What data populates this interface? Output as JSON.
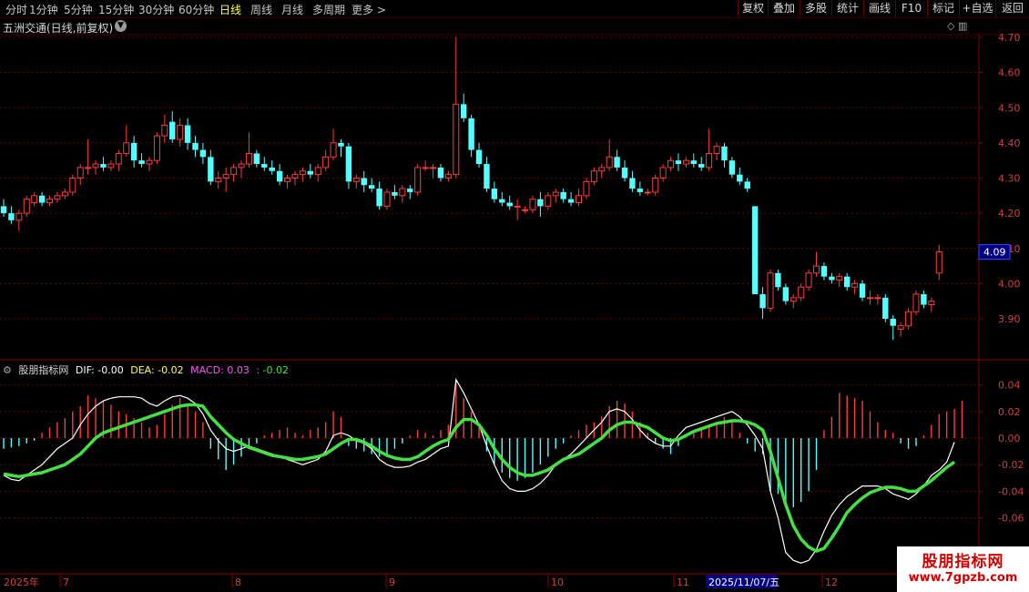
{
  "periods": [
    "分时",
    "1分钟",
    "5分钟",
    "15分钟",
    "30分钟",
    "60分钟",
    "日线",
    "周线",
    "月线",
    "多周期",
    "更多 >"
  ],
  "active_period": "日线",
  "right_buttons": [
    "复权",
    "叠加",
    "多股",
    "统计",
    "画线",
    "F10",
    "标记",
    "+自选",
    "返回"
  ],
  "stock_title": "五洲交通(日线,前复权)",
  "last_price_tag": "4.09",
  "macd_legend": {
    "name": "股朋指标网",
    "dif": "DIF: -0.00",
    "dea": "DEA: -0.02",
    "macd": "MACD: 0.03",
    "bar": ": -0.02"
  },
  "date_axis": {
    "year": "2025年",
    "months": [
      "7",
      "8",
      "9",
      "10",
      "11",
      "12"
    ],
    "highlight": "2025/11/07/五"
  },
  "watermark": {
    "line1": "股朋指标网",
    "line2": "www.7gpzb.com"
  },
  "colors": {
    "up": "#ff3b3b",
    "down": "#54ffff",
    "dif": "#ffffff",
    "dea": "#44e044",
    "axis": "#8a0000"
  },
  "chart_data": {
    "type": "candlestick",
    "price_axis": {
      "ticks": [
        4.7,
        4.6,
        4.5,
        4.4,
        4.3,
        4.2,
        4.1,
        4.0,
        3.9
      ],
      "range": [
        3.82,
        4.73
      ]
    },
    "macd_axis": {
      "ticks": [
        0.04,
        0.02,
        0.0,
        -0.02,
        -0.04,
        -0.06
      ],
      "range": [
        -0.098,
        0.058
      ]
    },
    "candles": [
      [
        4.22,
        4.24,
        4.19,
        4.2
      ],
      [
        4.2,
        4.22,
        4.17,
        4.18
      ],
      [
        4.18,
        4.21,
        4.15,
        4.2
      ],
      [
        4.2,
        4.25,
        4.19,
        4.24
      ],
      [
        4.23,
        4.26,
        4.22,
        4.25
      ],
      [
        4.25,
        4.26,
        4.22,
        4.23
      ],
      [
        4.23,
        4.25,
        4.22,
        4.24
      ],
      [
        4.24,
        4.26,
        4.23,
        4.25
      ],
      [
        4.25,
        4.27,
        4.24,
        4.26
      ],
      [
        4.26,
        4.31,
        4.25,
        4.3
      ],
      [
        4.3,
        4.34,
        4.28,
        4.33
      ],
      [
        4.33,
        4.41,
        4.31,
        4.33
      ],
      [
        4.33,
        4.35,
        4.31,
        4.34
      ],
      [
        4.34,
        4.36,
        4.32,
        4.33
      ],
      [
        4.33,
        4.35,
        4.32,
        4.34
      ],
      [
        4.34,
        4.38,
        4.32,
        4.37
      ],
      [
        4.37,
        4.45,
        4.36,
        4.4
      ],
      [
        4.4,
        4.42,
        4.33,
        4.35
      ],
      [
        4.35,
        4.37,
        4.33,
        4.34
      ],
      [
        4.34,
        4.36,
        4.32,
        4.35
      ],
      [
        4.35,
        4.43,
        4.34,
        4.42
      ],
      [
        4.42,
        4.48,
        4.4,
        4.45
      ],
      [
        4.46,
        4.49,
        4.4,
        4.41
      ],
      [
        4.41,
        4.47,
        4.39,
        4.45
      ],
      [
        4.45,
        4.47,
        4.38,
        4.4
      ],
      [
        4.4,
        4.42,
        4.36,
        4.38
      ],
      [
        4.38,
        4.4,
        4.34,
        4.36
      ],
      [
        4.36,
        4.38,
        4.28,
        4.29
      ],
      [
        4.29,
        4.32,
        4.27,
        4.3
      ],
      [
        4.3,
        4.33,
        4.26,
        4.31
      ],
      [
        4.31,
        4.34,
        4.29,
        4.33
      ],
      [
        4.33,
        4.35,
        4.3,
        4.34
      ],
      [
        4.34,
        4.43,
        4.33,
        4.37
      ],
      [
        4.37,
        4.38,
        4.33,
        4.34
      ],
      [
        4.34,
        4.36,
        4.32,
        4.33
      ],
      [
        4.33,
        4.35,
        4.31,
        4.32
      ],
      [
        4.32,
        4.34,
        4.28,
        4.29
      ],
      [
        4.29,
        4.31,
        4.27,
        4.3
      ],
      [
        4.3,
        4.32,
        4.28,
        4.31
      ],
      [
        4.31,
        4.33,
        4.29,
        4.32
      ],
      [
        4.32,
        4.34,
        4.3,
        4.31
      ],
      [
        4.31,
        4.34,
        4.29,
        4.33
      ],
      [
        4.33,
        4.38,
        4.32,
        4.36
      ],
      [
        4.36,
        4.44,
        4.35,
        4.4
      ],
      [
        4.4,
        4.41,
        4.36,
        4.39
      ],
      [
        4.39,
        4.4,
        4.27,
        4.29
      ],
      [
        4.29,
        4.31,
        4.27,
        4.3
      ],
      [
        4.3,
        4.32,
        4.26,
        4.28
      ],
      [
        4.28,
        4.3,
        4.26,
        4.27
      ],
      [
        4.27,
        4.29,
        4.21,
        4.22
      ],
      [
        4.22,
        4.27,
        4.21,
        4.26
      ],
      [
        4.26,
        4.28,
        4.24,
        4.25
      ],
      [
        4.25,
        4.28,
        4.23,
        4.27
      ],
      [
        4.27,
        4.28,
        4.24,
        4.26
      ],
      [
        4.26,
        4.34,
        4.25,
        4.33
      ],
      [
        4.33,
        4.35,
        4.32,
        4.33
      ],
      [
        4.33,
        4.34,
        4.3,
        4.33
      ],
      [
        4.33,
        4.34,
        4.29,
        4.3
      ],
      [
        4.3,
        4.32,
        4.29,
        4.31
      ],
      [
        4.31,
        4.7,
        4.3,
        4.51
      ],
      [
        4.51,
        4.54,
        4.46,
        4.47
      ],
      [
        4.47,
        4.48,
        4.36,
        4.38
      ],
      [
        4.38,
        4.4,
        4.33,
        4.34
      ],
      [
        4.34,
        4.36,
        4.26,
        4.27
      ],
      [
        4.27,
        4.29,
        4.23,
        4.24
      ],
      [
        4.24,
        4.26,
        4.22,
        4.23
      ],
      [
        4.23,
        4.25,
        4.21,
        4.22
      ],
      [
        4.22,
        4.24,
        4.18,
        4.22
      ],
      [
        4.21,
        4.22,
        4.2,
        4.21
      ],
      [
        4.21,
        4.25,
        4.2,
        4.24
      ],
      [
        4.24,
        4.26,
        4.19,
        4.22
      ],
      [
        4.22,
        4.26,
        4.21,
        4.25
      ],
      [
        4.25,
        4.27,
        4.23,
        4.26
      ],
      [
        4.26,
        4.27,
        4.23,
        4.24
      ],
      [
        4.24,
        4.26,
        4.22,
        4.23
      ],
      [
        4.23,
        4.27,
        4.22,
        4.25
      ],
      [
        4.25,
        4.3,
        4.24,
        4.29
      ],
      [
        4.29,
        4.33,
        4.28,
        4.32
      ],
      [
        4.32,
        4.34,
        4.3,
        4.33
      ],
      [
        4.33,
        4.41,
        4.32,
        4.36
      ],
      [
        4.36,
        4.38,
        4.32,
        4.33
      ],
      [
        4.33,
        4.35,
        4.29,
        4.3
      ],
      [
        4.3,
        4.32,
        4.26,
        4.27
      ],
      [
        4.27,
        4.29,
        4.25,
        4.26
      ],
      [
        4.26,
        4.27,
        4.25,
        4.26
      ],
      [
        4.26,
        4.31,
        4.25,
        4.3
      ],
      [
        4.3,
        4.34,
        4.29,
        4.33
      ],
      [
        4.33,
        4.36,
        4.32,
        4.35
      ],
      [
        4.35,
        4.37,
        4.32,
        4.34
      ],
      [
        4.34,
        4.36,
        4.33,
        4.35
      ],
      [
        4.35,
        4.37,
        4.33,
        4.34
      ],
      [
        4.34,
        4.36,
        4.32,
        4.33
      ],
      [
        4.33,
        4.44,
        4.32,
        4.37
      ],
      [
        4.37,
        4.4,
        4.35,
        4.39
      ],
      [
        4.39,
        4.4,
        4.33,
        4.35
      ],
      [
        4.35,
        4.36,
        4.3,
        4.31
      ],
      [
        4.31,
        4.33,
        4.28,
        4.29
      ],
      [
        4.29,
        4.3,
        4.26,
        4.27
      ],
      [
        4.22,
        4.22,
        3.97,
        3.97
      ],
      [
        3.97,
        3.99,
        3.9,
        3.93
      ],
      [
        3.93,
        4.04,
        3.92,
        4.03
      ],
      [
        4.03,
        4.04,
        3.98,
        3.99
      ],
      [
        3.99,
        4.0,
        3.94,
        3.95
      ],
      [
        3.95,
        3.97,
        3.93,
        3.96
      ],
      [
        3.96,
        4.0,
        3.95,
        3.99
      ],
      [
        3.99,
        4.04,
        3.98,
        4.03
      ],
      [
        4.03,
        4.09,
        4.02,
        4.05
      ],
      [
        4.05,
        4.06,
        4.01,
        4.02
      ],
      [
        4.02,
        4.03,
        4.0,
        4.01
      ],
      [
        4.01,
        4.03,
        3.99,
        4.02
      ],
      [
        4.02,
        4.03,
        3.98,
        3.99
      ],
      [
        3.99,
        4.01,
        3.97,
        4.0
      ],
      [
        4.0,
        4.01,
        3.95,
        3.96
      ],
      [
        3.96,
        3.98,
        3.94,
        3.96
      ],
      [
        3.96,
        3.97,
        3.94,
        3.96
      ],
      [
        3.96,
        3.97,
        3.89,
        3.9
      ],
      [
        3.9,
        3.91,
        3.84,
        3.88
      ],
      [
        3.87,
        3.89,
        3.85,
        3.88
      ],
      [
        3.88,
        3.93,
        3.87,
        3.92
      ],
      [
        3.92,
        3.98,
        3.91,
        3.97
      ],
      [
        3.97,
        3.98,
        3.93,
        3.94
      ],
      [
        3.94,
        3.96,
        3.92,
        3.95
      ],
      [
        4.03,
        4.11,
        4.01,
        4.09
      ]
    ],
    "macd_hist": [
      -0.008,
      -0.007,
      -0.006,
      -0.004,
      -0.002,
      0.004,
      0.008,
      0.012,
      0.015,
      0.02,
      0.024,
      0.032,
      0.03,
      0.028,
      0.025,
      0.02,
      0.018,
      0.015,
      0.012,
      0.008,
      0.01,
      0.018,
      0.025,
      0.03,
      0.026,
      0.02,
      0.012,
      -0.008,
      -0.016,
      -0.024,
      -0.02,
      -0.014,
      -0.008,
      -0.004,
      0.002,
      0.004,
      0.006,
      0.008,
      0.004,
      0.002,
      0.006,
      0.008,
      0.012,
      0.02,
      0.016,
      -0.006,
      -0.008,
      -0.01,
      -0.012,
      -0.014,
      -0.012,
      -0.008,
      -0.004,
      0.002,
      0.006,
      0.004,
      0.002,
      0.006,
      0.01,
      0.043,
      0.03,
      0.02,
      0.01,
      -0.01,
      -0.02,
      -0.026,
      -0.03,
      -0.032,
      -0.03,
      -0.026,
      -0.02,
      -0.014,
      -0.008,
      -0.004,
      0.002,
      0.006,
      0.01,
      0.012,
      0.016,
      0.024,
      0.028,
      0.026,
      0.02,
      0.012,
      0.004,
      -0.004,
      -0.008,
      -0.012,
      -0.006,
      0.002,
      0.006,
      0.008,
      0.01,
      0.012,
      0.016,
      0.012,
      0.004,
      -0.004,
      -0.01,
      -0.012,
      -0.04,
      -0.042,
      -0.05,
      -0.052,
      -0.048,
      -0.04,
      -0.024,
      0.006,
      0.016,
      0.034,
      0.032,
      0.03,
      0.028,
      0.02,
      0.012,
      0.006,
      0.004,
      -0.004,
      -0.008,
      -0.006,
      0.002,
      0.01,
      0.018,
      0.02,
      0.022,
      0.028
    ],
    "dif": [
      -0.028,
      -0.031,
      -0.032,
      -0.028,
      -0.024,
      -0.02,
      -0.014,
      -0.008,
      -0.004,
      0.0,
      0.01,
      0.018,
      0.024,
      0.028,
      0.03,
      0.031,
      0.031,
      0.031,
      0.03,
      0.026,
      0.024,
      0.028,
      0.031,
      0.032,
      0.03,
      0.026,
      0.018,
      0.006,
      -0.002,
      -0.008,
      -0.01,
      -0.008,
      -0.006,
      -0.008,
      -0.01,
      -0.012,
      -0.014,
      -0.016,
      -0.018,
      -0.02,
      -0.018,
      -0.016,
      -0.01,
      0.002,
      0.004,
      0.002,
      -0.002,
      -0.004,
      -0.008,
      -0.016,
      -0.02,
      -0.022,
      -0.022,
      -0.021,
      -0.018,
      -0.016,
      -0.012,
      -0.008,
      -0.006,
      0.044,
      0.034,
      0.022,
      0.01,
      -0.006,
      -0.02,
      -0.032,
      -0.038,
      -0.04,
      -0.04,
      -0.038,
      -0.034,
      -0.028,
      -0.02,
      -0.016,
      -0.012,
      -0.006,
      0.0,
      0.006,
      0.012,
      0.02,
      0.022,
      0.02,
      0.014,
      0.006,
      0.0,
      -0.004,
      -0.006,
      -0.006,
      0.002,
      0.008,
      0.01,
      0.012,
      0.014,
      0.016,
      0.018,
      0.02,
      0.016,
      0.01,
      0.002,
      -0.008,
      -0.04,
      -0.06,
      -0.086,
      -0.092,
      -0.094,
      -0.092,
      -0.084,
      -0.07,
      -0.058,
      -0.05,
      -0.044,
      -0.04,
      -0.036,
      -0.036,
      -0.036,
      -0.038,
      -0.042,
      -0.044,
      -0.046,
      -0.042,
      -0.036,
      -0.028,
      -0.024,
      -0.018,
      -0.003
    ],
    "dea": [
      -0.027,
      -0.028,
      -0.029,
      -0.028,
      -0.027,
      -0.026,
      -0.024,
      -0.022,
      -0.02,
      -0.016,
      -0.012,
      -0.006,
      0.0,
      0.004,
      0.006,
      0.008,
      0.01,
      0.012,
      0.014,
      0.016,
      0.018,
      0.02,
      0.022,
      0.024,
      0.025,
      0.025,
      0.024,
      0.016,
      0.01,
      0.004,
      -0.001,
      -0.004,
      -0.007,
      -0.009,
      -0.011,
      -0.013,
      -0.014,
      -0.015,
      -0.016,
      -0.016,
      -0.015,
      -0.014,
      -0.012,
      -0.008,
      -0.004,
      -0.001,
      -0.001,
      -0.003,
      -0.006,
      -0.01,
      -0.013,
      -0.015,
      -0.016,
      -0.016,
      -0.014,
      -0.01,
      -0.006,
      -0.003,
      -0.001,
      0.008,
      0.014,
      0.014,
      0.01,
      0.002,
      -0.008,
      -0.016,
      -0.022,
      -0.026,
      -0.028,
      -0.028,
      -0.026,
      -0.024,
      -0.02,
      -0.016,
      -0.014,
      -0.012,
      -0.008,
      -0.004,
      0.0,
      0.006,
      0.01,
      0.012,
      0.012,
      0.01,
      0.008,
      0.004,
      0.0,
      -0.002,
      -0.001,
      0.002,
      0.005,
      0.007,
      0.009,
      0.011,
      0.012,
      0.013,
      0.013,
      0.012,
      0.01,
      0.006,
      -0.01,
      -0.03,
      -0.05,
      -0.066,
      -0.076,
      -0.082,
      -0.085,
      -0.083,
      -0.075,
      -0.066,
      -0.056,
      -0.05,
      -0.045,
      -0.041,
      -0.039,
      -0.037,
      -0.037,
      -0.038,
      -0.04,
      -0.04,
      -0.036,
      -0.032,
      -0.027,
      -0.022,
      -0.018
    ]
  }
}
